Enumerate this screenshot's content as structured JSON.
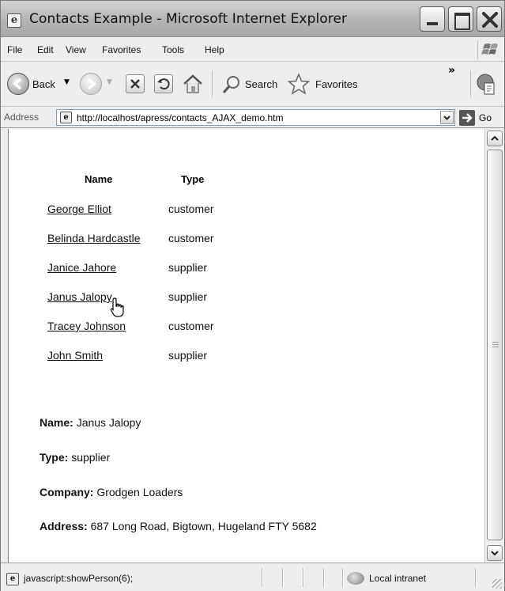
{
  "window": {
    "title": "Contacts Example - Microsoft Internet Explorer"
  },
  "menu": [
    "File",
    "Edit",
    "View",
    "Favorites",
    "Tools",
    "Help"
  ],
  "toolbar": {
    "back_label": "Back",
    "search_label": "Search",
    "favorites_label": "Favorites",
    "chevron": "»"
  },
  "address": {
    "label": "Address",
    "url": "http://localhost/apress/contacts_AJAX_demo.htm",
    "go_label": "Go"
  },
  "table": {
    "headers": [
      "Name",
      "Type"
    ],
    "rows": [
      {
        "name": "George Elliot",
        "type": "customer"
      },
      {
        "name": "Belinda Hardcastle",
        "type": "customer"
      },
      {
        "name": "Janice Jahore",
        "type": "supplier"
      },
      {
        "name": "Janus Jalopy",
        "type": "supplier"
      },
      {
        "name": "Tracey Johnson",
        "type": "customer"
      },
      {
        "name": "John Smith",
        "type": "supplier"
      }
    ]
  },
  "details": {
    "name_label": "Name:",
    "name_value": "Janus Jalopy",
    "type_label": "Type:",
    "type_value": "supplier",
    "company_label": "Company:",
    "company_value": "Grodgen Loaders",
    "address_label": "Address:",
    "address_value": "687 Long Road, Bigtown, Hugeland FTY 5682"
  },
  "status": {
    "text": "javascript:showPerson(6);",
    "zone": "Local intranet"
  },
  "icons": {
    "page": "ie-page-icon",
    "back": "back-arrow-icon",
    "forward": "forward-arrow-icon",
    "stop": "stop-icon",
    "refresh": "refresh-icon",
    "home": "home-icon",
    "search": "search-magnifier-icon",
    "favorites": "favorites-star-icon",
    "zone": "intranet-globe-icon"
  }
}
